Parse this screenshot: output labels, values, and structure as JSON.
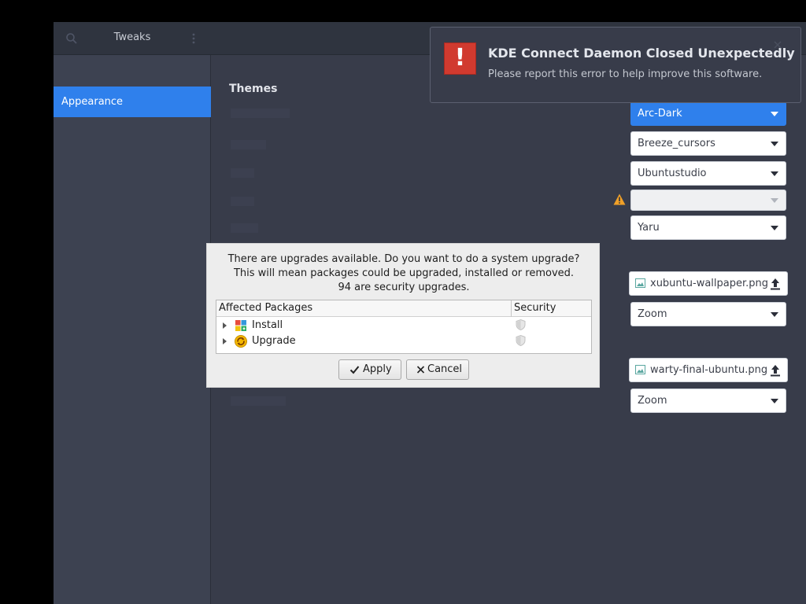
{
  "tweaks": {
    "title": "Tweaks",
    "sidebar": {
      "items": [
        {
          "label": "Appearance",
          "selected": true
        }
      ]
    },
    "section_title": "Themes",
    "combos": [
      {
        "value": "Arc-Dark",
        "active": true
      },
      {
        "value": "Breeze_cursors"
      },
      {
        "value": "Ubuntustudio"
      },
      {
        "value": "",
        "disabled": true,
        "warning": true
      },
      {
        "value": "Yaru"
      }
    ],
    "background": {
      "file": "xubuntu-wallpaper.png",
      "adjustment": "Zoom"
    },
    "lock_screen": {
      "file": "warty-final-ubuntu.png",
      "adjustment": "Zoom"
    },
    "colors": {
      "accent": "#2f80ec",
      "window_bg": "#383c4a",
      "sidebar_bg": "#3d4251",
      "header_bg": "#2f343f"
    }
  },
  "notification": {
    "title": "KDE Connect Daemon Closed Unexpectedly",
    "body": "Please report this error to help improve this software.",
    "icon": "error-icon",
    "icon_text": "!",
    "icon_color": "#d13a2f"
  },
  "dialog": {
    "message_lines": [
      "There are upgrades available. Do you want to do a system upgrade?",
      "This will mean packages could be upgraded, installed or removed.",
      "94 are security upgrades."
    ],
    "columns": [
      "Affected Packages",
      "Security"
    ],
    "rows": [
      {
        "label": "Install",
        "icon": "install-package-icon"
      },
      {
        "label": "Upgrade",
        "icon": "upgrade-package-icon"
      }
    ],
    "apply_label": "Apply",
    "cancel_label": "Cancel"
  }
}
